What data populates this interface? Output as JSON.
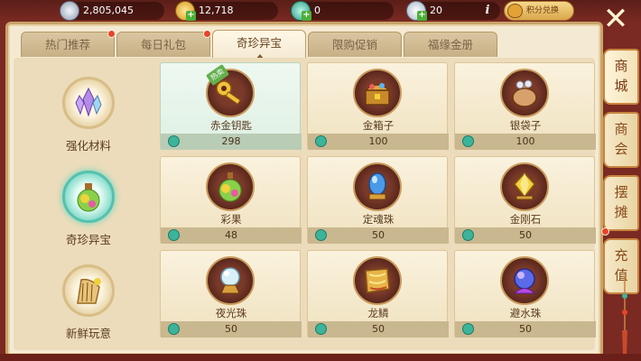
{
  "currencies": [
    {
      "name": "silver",
      "value": "2,805,045",
      "icon": "silver-coin-icon",
      "plus": false
    },
    {
      "name": "gold",
      "value": "12,718",
      "icon": "gold-ingot-icon",
      "plus": true
    },
    {
      "name": "jade",
      "value": "0",
      "icon": "jade-icon",
      "plus": true
    },
    {
      "name": "silver-bar",
      "value": "20",
      "icon": "silver-bar-icon",
      "plus": true
    }
  ],
  "info_label": "i",
  "exchange_label": "积分兑换",
  "close_label": "✕",
  "tabs": [
    {
      "label": "热门推荐",
      "badge": true
    },
    {
      "label": "每日礼包",
      "badge": true
    },
    {
      "label": "奇珍异宝",
      "badge": false,
      "active": true
    },
    {
      "label": "限购促销",
      "badge": false
    },
    {
      "label": "福缘金册",
      "badge": false
    }
  ],
  "categories": [
    {
      "label": "强化材料",
      "icon": "crystal-icon"
    },
    {
      "label": "奇珍异宝",
      "icon": "potion-icon",
      "active": true
    },
    {
      "label": "新鲜玩意",
      "icon": "harp-icon"
    }
  ],
  "items": [
    {
      "name": "赤金钥匙",
      "price": "298",
      "icon": "key-icon",
      "hot": "热卖",
      "selected": true
    },
    {
      "name": "金箱子",
      "price": "100",
      "icon": "chest-icon"
    },
    {
      "name": "银袋子",
      "price": "100",
      "icon": "bag-icon"
    },
    {
      "name": "彩果",
      "price": "48",
      "icon": "fruit-icon"
    },
    {
      "name": "定魂珠",
      "price": "50",
      "icon": "blue-orb-icon"
    },
    {
      "name": "金刚石",
      "price": "50",
      "icon": "diamond-icon"
    },
    {
      "name": "夜光珠",
      "price": "50",
      "icon": "pearl-icon"
    },
    {
      "name": "龙鳞",
      "price": "50",
      "icon": "dragon-scale-icon"
    },
    {
      "name": "避水珠",
      "price": "50",
      "icon": "water-orb-icon"
    }
  ],
  "side_tabs": [
    {
      "label": "商城",
      "active": true
    },
    {
      "label": "商会"
    },
    {
      "label": "摆摊"
    },
    {
      "label": "充值",
      "badge": true
    }
  ],
  "colors": {
    "accent": "#53c2ae",
    "badge": "#e8432c",
    "frame": "#c9a46a"
  }
}
